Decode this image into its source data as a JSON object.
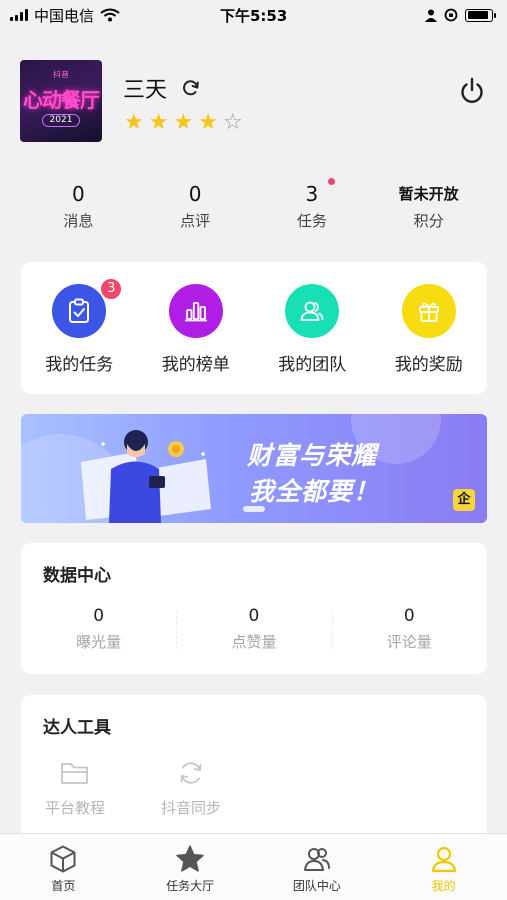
{
  "status_bar": {
    "carrier": "中国电信",
    "time": "下午5:53",
    "battery_level": 0.9
  },
  "profile": {
    "avatar": {
      "brand": "抖音",
      "logo_text": "心动餐厅",
      "year": "2021"
    },
    "name": "三天",
    "rating": 4,
    "rating_max": 5
  },
  "stats": [
    {
      "value": "0",
      "label": "消息"
    },
    {
      "value": "0",
      "label": "点评"
    },
    {
      "value": "3",
      "label": "任务"
    },
    {
      "value": "暂未开放",
      "label": "积分"
    }
  ],
  "quick_menu": [
    {
      "label": "我的任务",
      "icon": "clipboard-check-icon",
      "color": "#3b55e6",
      "badge": "3"
    },
    {
      "label": "我的榜单",
      "icon": "bar-chart-icon",
      "color": "#b01ee6"
    },
    {
      "label": "我的团队",
      "icon": "team-icon",
      "color": "#19e0b4"
    },
    {
      "label": "我的奖励",
      "icon": "gift-icon",
      "color": "#f7dc12"
    }
  ],
  "banner": {
    "title": "财富与荣耀",
    "subtitle": "我全都要！",
    "logo": "企"
  },
  "data_center": {
    "title": "数据中心",
    "items": [
      {
        "value": "0",
        "label": "曝光量"
      },
      {
        "value": "0",
        "label": "点赞量"
      },
      {
        "value": "0",
        "label": "评论量"
      }
    ]
  },
  "tools": {
    "title": "达人工具",
    "items": [
      {
        "label": "平台教程",
        "icon": "folder-icon"
      },
      {
        "label": "抖音同步",
        "icon": "sync-icon"
      }
    ]
  },
  "tab_bar": {
    "tabs": [
      {
        "label": "首页",
        "icon": "cube-icon"
      },
      {
        "label": "任务大厅",
        "icon": "star-icon"
      },
      {
        "label": "团队中心",
        "icon": "team-icon"
      },
      {
        "label": "我的",
        "icon": "user-icon",
        "active": true
      }
    ],
    "active_color": "#f0c800"
  }
}
